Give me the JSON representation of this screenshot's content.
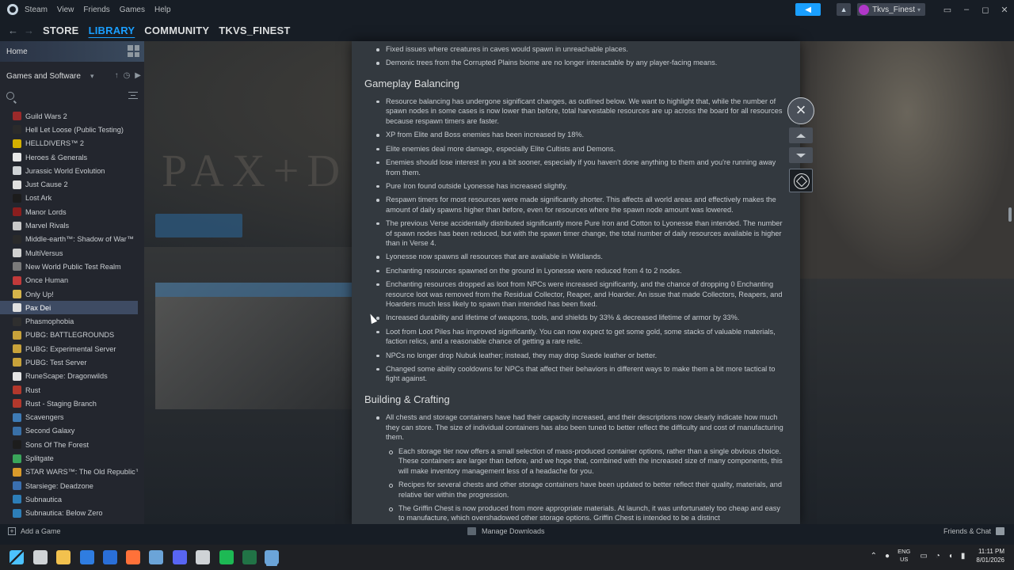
{
  "menubar": {
    "items": [
      "Steam",
      "View",
      "Friends",
      "Games",
      "Help"
    ],
    "user_name": "Tkvs_Finest",
    "bell_icon": "bell-icon",
    "announce_icon": "megaphone-icon"
  },
  "nav": {
    "links": [
      "STORE",
      "LIBRARY",
      "COMMUNITY",
      "TKVS_FINEST"
    ],
    "active": "LIBRARY"
  },
  "sidebar": {
    "home_label": "Home",
    "filter_label": "Games and Software",
    "games": [
      {
        "name": "Guild Wars 2",
        "color": "#9b2a2a"
      },
      {
        "name": "Hell Let Loose (Public Testing)",
        "color": "#2b2b2b"
      },
      {
        "name": "HELLDIVERS™ 2",
        "color": "#d4b000"
      },
      {
        "name": "Heroes & Generals",
        "color": "#e8e8e8"
      },
      {
        "name": "Jurassic World Evolution",
        "color": "#cfd3d6"
      },
      {
        "name": "Just Cause 2",
        "color": "#e0e0e0"
      },
      {
        "name": "Lost Ark",
        "color": "#1c1c1c"
      },
      {
        "name": "Manor Lords",
        "color": "#8b1e1e"
      },
      {
        "name": "Marvel Rivals",
        "color": "#c9c9c9"
      },
      {
        "name": "Middle-earth™: Shadow of War™",
        "color": "#2a2a2a"
      },
      {
        "name": "MultiVersus",
        "color": "#d0d0d0"
      },
      {
        "name": "New World Public Test Realm",
        "color": "#7a7a7a"
      },
      {
        "name": "Once Human",
        "color": "#c23a3a"
      },
      {
        "name": "Only Up!",
        "color": "#d6b44a"
      },
      {
        "name": "Pax Dei",
        "color": "#e0e0e0",
        "selected": true
      },
      {
        "name": "Phasmophobia",
        "color": "#2f2f2f"
      },
      {
        "name": "PUBG: BATTLEGROUNDS",
        "color": "#c8a23a"
      },
      {
        "name": "PUBG: Experimental Server",
        "color": "#c8a23a"
      },
      {
        "name": "PUBG: Test Server",
        "color": "#c8a23a"
      },
      {
        "name": "RuneScape: Dragonwilds",
        "color": "#e5e5e5"
      },
      {
        "name": "Rust",
        "color": "#b3382c"
      },
      {
        "name": "Rust - Staging Branch",
        "color": "#b3382c"
      },
      {
        "name": "Scavengers",
        "color": "#3e7bb6"
      },
      {
        "name": "Second Galaxy",
        "color": "#3970a8"
      },
      {
        "name": "Sons Of The Forest",
        "color": "#1d1d1d"
      },
      {
        "name": "Splitgate",
        "color": "#3aa55a"
      },
      {
        "name": "STAR WARS™: The Old Republic™",
        "color": "#d99a2b"
      },
      {
        "name": "Starsiege: Deadzone",
        "color": "#3a6fb0"
      },
      {
        "name": "Subnautica",
        "color": "#2d7eb8"
      },
      {
        "name": "Subnautica: Below Zero",
        "color": "#2d7eb8"
      }
    ],
    "add_game": "Add a Game"
  },
  "bottom": {
    "downloads": "Manage Downloads",
    "friends": "Friends & Chat"
  },
  "background": {
    "logo_text": "PAX+D"
  },
  "patch_notes": {
    "top_items": [
      "Fixed issues where creatures in caves would spawn in unreachable places.",
      "Demonic trees from the Corrupted Plains biome are no longer interactable by any player-facing means."
    ],
    "sections": [
      {
        "title": "Gameplay Balancing",
        "items": [
          "Resource balancing has undergone significant changes, as outlined below. We want to highlight that, while the number of spawn nodes in some cases is now lower than before, total harvestable resources are up across the board for all resources because respawn timers are faster.",
          "XP from Elite and Boss enemies has been increased by 18%.",
          "Elite enemies deal more damage, especially Elite Cultists and Demons.",
          "Enemies should lose interest in you a bit sooner, especially if you haven't done anything to them and you're running away from them.",
          "Pure Iron found outside Lyonesse has increased slightly.",
          "Respawn timers for most resources were made significantly shorter. This affects all world areas and effectively makes the amount of daily spawns higher than before, even for resources where the spawn node amount was lowered.",
          "The previous Verse accidentally distributed significantly more Pure Iron and Cotton to Lyonesse than intended. The number of spawn nodes has been reduced, but with the spawn timer change, the total number of daily resources available is higher than in Verse 4.",
          "Lyonesse now spawns all resources that are available in Wildlands.",
          "Enchanting resources spawned on the ground in Lyonesse were reduced from 4 to 2 nodes.",
          "Enchanting resources dropped as loot from NPCs were increased significantly, and the chance of dropping 0 Enchanting resource loot was removed from the Residual Collector, Reaper, and Hoarder. An issue that made Collectors, Reapers, and Hoarders much less likely to spawn than intended has been fixed.",
          "Increased durability and lifetime of weapons, tools, and shields by 33% & decreased lifetime of armor by 33%.",
          "Loot from Loot Piles has improved significantly. You can now expect to get some gold, some stacks of valuable materials, faction relics, and a reasonable chance of getting a rare relic.",
          "NPCs no longer drop Nubuk leather; instead, they may drop Suede leather or better.",
          "Changed some ability cooldowns for NPCs that affect their behaviors in different ways to make them a bit more tactical to fight against."
        ]
      },
      {
        "title": "Building & Crafting",
        "items": [
          "All chests and storage containers have had their capacity increased, and their descriptions now clearly indicate how much they can store. The size of individual containers has also been tuned to better reflect the difficulty and cost of manufacturing them."
        ],
        "sub_items": [
          "Each storage tier now offers a small selection of mass-produced container options, rather than a single obvious choice. These containers are larger than before, and we hope that, combined with the increased size of many components, this will make inventory management less of a headache for you.",
          "Recipes for several chests and other storage containers have been updated to better reflect their quality, materials, and relative tier within the progression.",
          "The Griffin Chest is now produced from more appropriate materials. At launch, it was unfortunately too cheap and easy to manufacture, which overshadowed other storage options. Griffin Chest is intended to be a distinct"
        ]
      }
    ]
  },
  "tray": {
    "lang_top": "ENG",
    "lang_bottom": "US",
    "time": "11:11 PM",
    "date": "8/01/2026"
  },
  "taskbar_apps": [
    {
      "name": "start-icon",
      "color": "#3aa0ff"
    },
    {
      "name": "task-view-icon",
      "color": "#cfd3d6"
    },
    {
      "name": "file-explorer-icon",
      "color": "#f2c14e"
    },
    {
      "name": "store-icon",
      "color": "#2f7de1"
    },
    {
      "name": "outlook-icon",
      "color": "#2a6fd8"
    },
    {
      "name": "firefox-icon",
      "color": "#ff7139"
    },
    {
      "name": "steam-icon",
      "color": "#6ba4d8"
    },
    {
      "name": "discord-icon",
      "color": "#5865f2"
    },
    {
      "name": "xbox-icon",
      "color": "#cfd3d6"
    },
    {
      "name": "spotify-icon",
      "color": "#1db954"
    },
    {
      "name": "excel-icon",
      "color": "#217346"
    },
    {
      "name": "steam-active-icon",
      "color": "#6ba4d8"
    }
  ]
}
